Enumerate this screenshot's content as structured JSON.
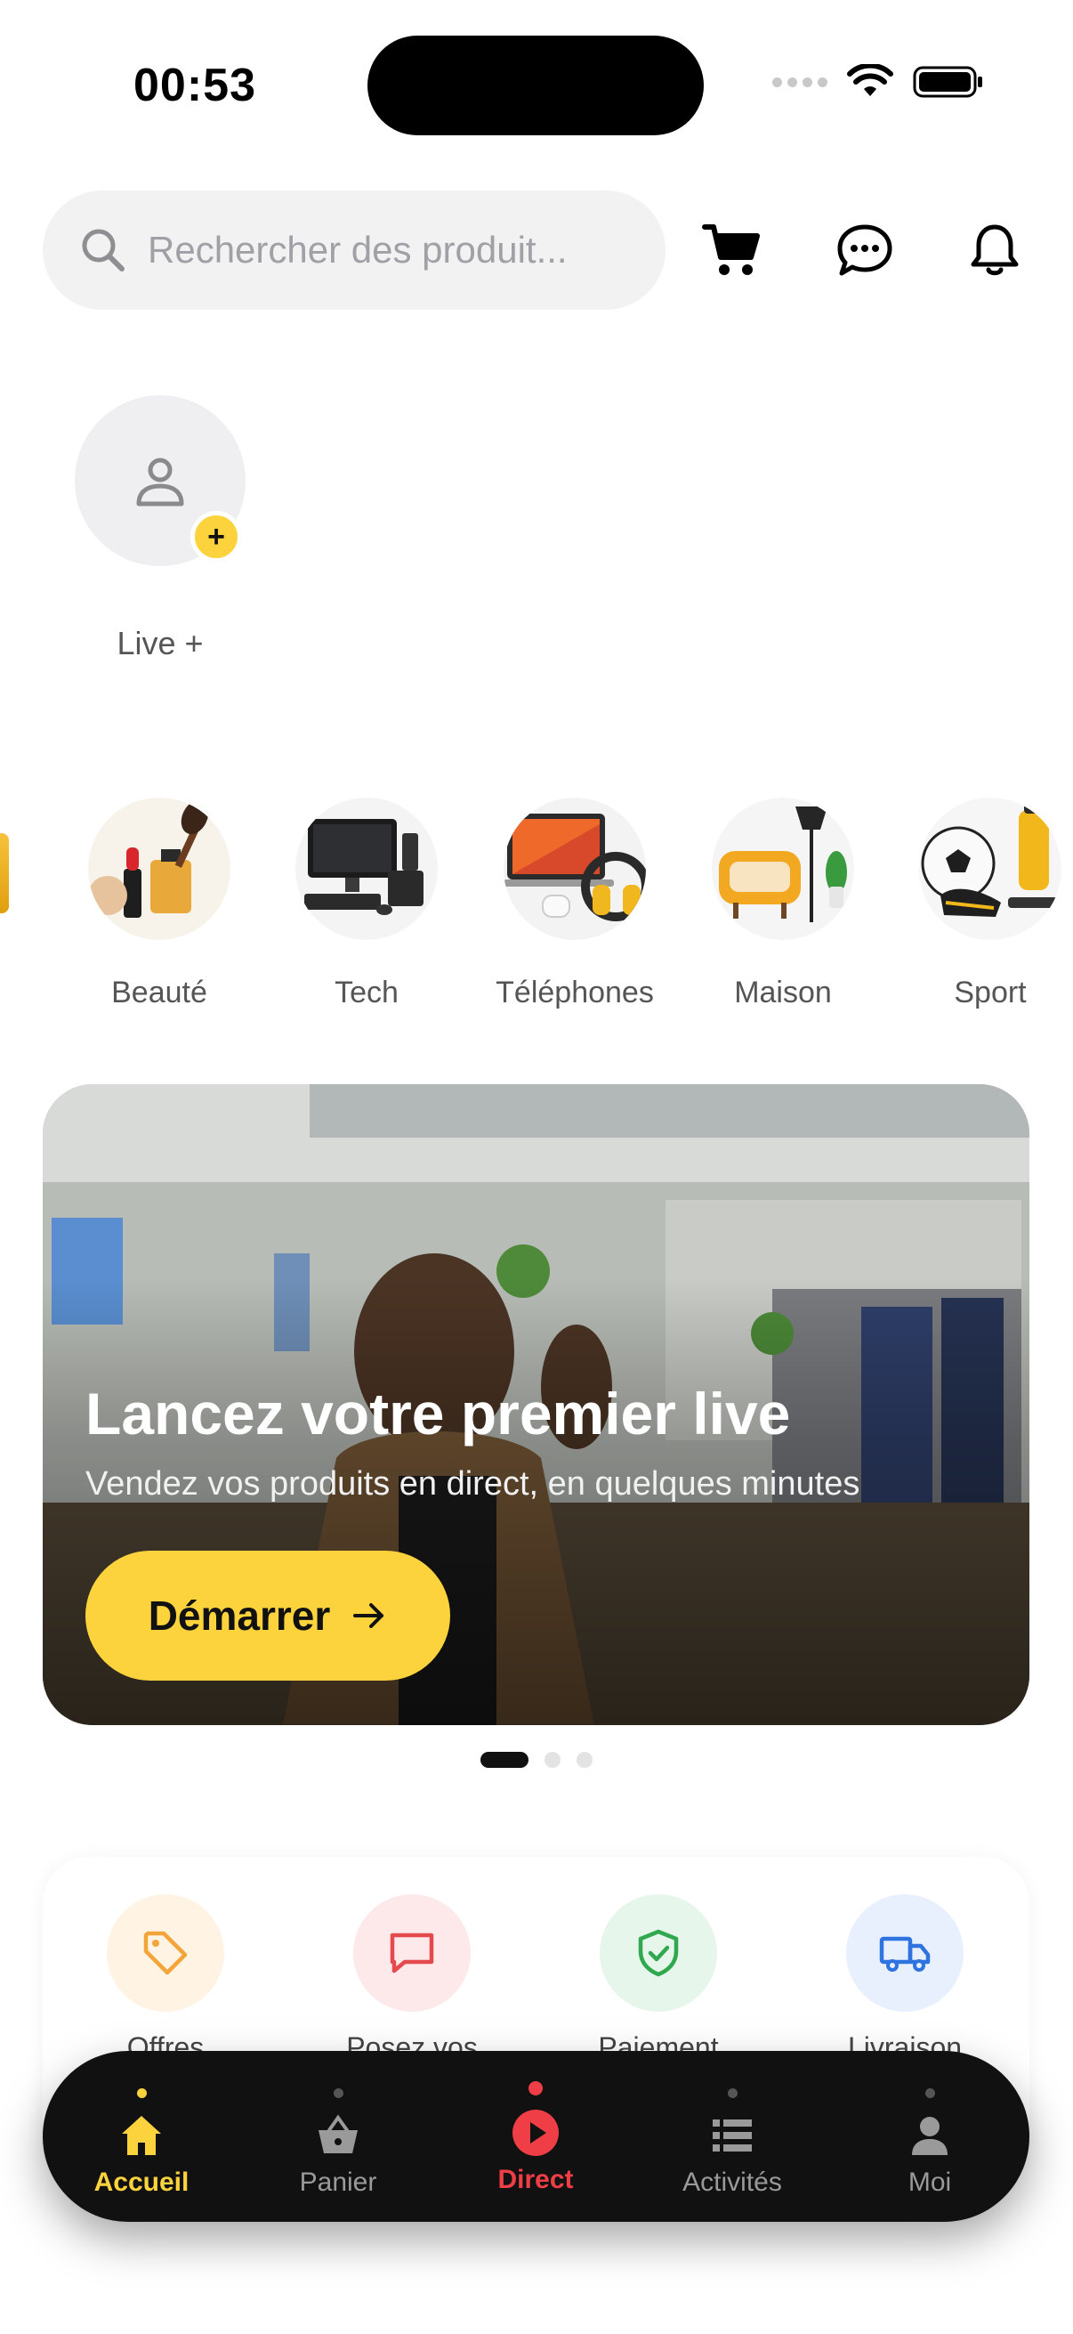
{
  "status_bar": {
    "time": "00:53"
  },
  "search": {
    "placeholder": "Rechercher des produit..."
  },
  "header": {
    "icons": [
      "cart-icon",
      "chat-icon",
      "bell-icon"
    ]
  },
  "live_story": {
    "label": "Live +",
    "badge": "+"
  },
  "categories": [
    {
      "label": "Beauté"
    },
    {
      "label": "Tech"
    },
    {
      "label": "Téléphones"
    },
    {
      "label": "Maison"
    },
    {
      "label": "Sport"
    }
  ],
  "banner": {
    "title": "Lancez votre premier live",
    "subtitle": "Vendez vos produits en direct, en quelques minutes",
    "button_label": "Démarrer",
    "button_icon": "→",
    "page_count": 3,
    "active_page": 1
  },
  "features": [
    {
      "label": "Offres",
      "icon": "tag-icon",
      "color": "#f3a53a",
      "bg": "#fff4e4"
    },
    {
      "label": "Posez vos",
      "icon": "message-square-icon",
      "color": "#e5484d",
      "bg": "#fde9ea"
    },
    {
      "label": "Paiement",
      "icon": "shield-check-icon",
      "color": "#2fa84f",
      "bg": "#e6f6ea"
    },
    {
      "label": "Livraison",
      "icon": "truck-icon",
      "color": "#2f73e0",
      "bg": "#e8f0fd"
    }
  ],
  "tabbar": {
    "items": [
      {
        "label": "Accueil",
        "icon": "home-icon"
      },
      {
        "label": "Panier",
        "icon": "basket-icon"
      },
      {
        "label": "Direct",
        "icon": "play-circle-icon"
      },
      {
        "label": "Activités",
        "icon": "list-icon"
      },
      {
        "label": "Moi",
        "icon": "user-icon"
      }
    ]
  },
  "colors": {
    "accent": "#fcd33c",
    "live": "#ef3e45",
    "tabbar": "#111111"
  }
}
